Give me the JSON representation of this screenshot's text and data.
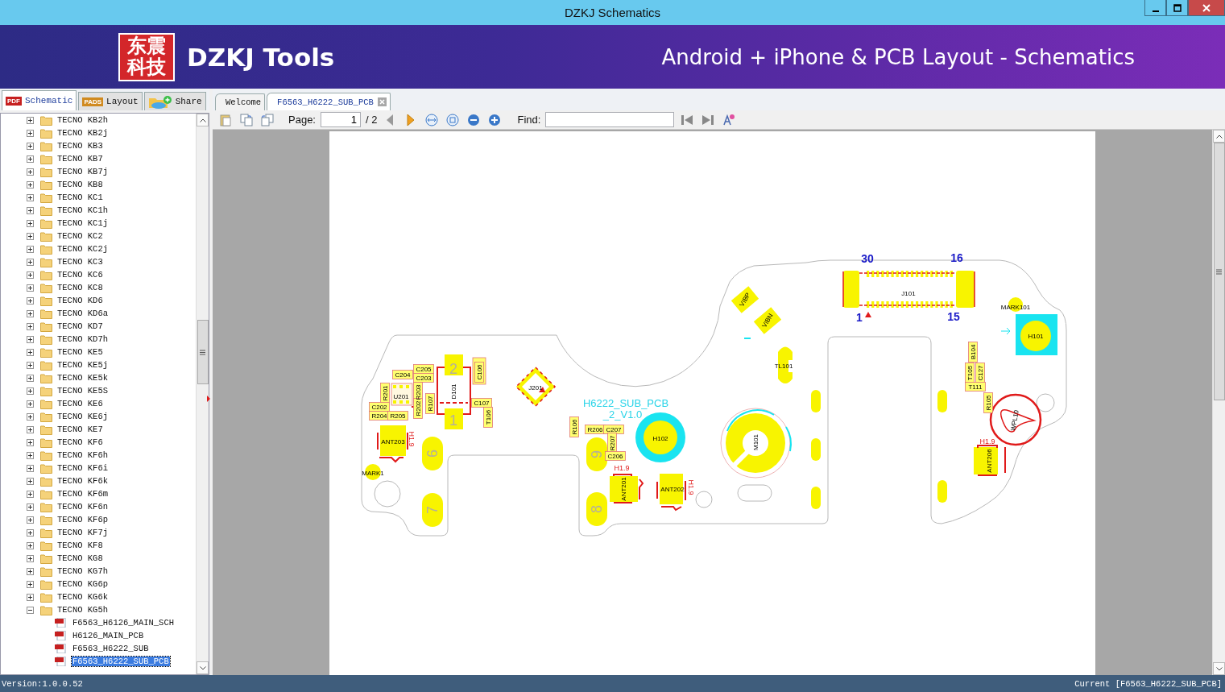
{
  "window": {
    "title": "DZKJ Schematics"
  },
  "banner": {
    "logo_text": "东震科技",
    "brand": "DZKJ Tools",
    "tagline": "Android + iPhone & PCB Layout - Schematics"
  },
  "panel_tabs": [
    {
      "label": "Schematic",
      "badge": "PDF",
      "selected": true
    },
    {
      "label": "Layout",
      "badge": "PADS",
      "selected": false
    },
    {
      "label": "Share",
      "selected": false
    }
  ],
  "doc_tabs": [
    {
      "label": "Welcome",
      "selected": false,
      "closable": false
    },
    {
      "label": "F6563_H6222_SUB_PCB",
      "selected": true,
      "closable": true
    }
  ],
  "tree": [
    {
      "label": "TECNO KB2h",
      "expanded": false
    },
    {
      "label": "TECNO KB2j",
      "expanded": false
    },
    {
      "label": "TECNO KB3",
      "expanded": false
    },
    {
      "label": "TECNO KB7",
      "expanded": false
    },
    {
      "label": "TECNO KB7j",
      "expanded": false
    },
    {
      "label": "TECNO KB8",
      "expanded": false
    },
    {
      "label": "TECNO KC1",
      "expanded": false
    },
    {
      "label": "TECNO KC1h",
      "expanded": false
    },
    {
      "label": "TECNO KC1j",
      "expanded": false
    },
    {
      "label": "TECNO KC2",
      "expanded": false
    },
    {
      "label": "TECNO KC2j",
      "expanded": false
    },
    {
      "label": "TECNO KC3",
      "expanded": false
    },
    {
      "label": "TECNO KC6",
      "expanded": false
    },
    {
      "label": "TECNO KC8",
      "expanded": false
    },
    {
      "label": "TECNO KD6",
      "expanded": false
    },
    {
      "label": "TECNO KD6a",
      "expanded": false
    },
    {
      "label": "TECNO KD7",
      "expanded": false
    },
    {
      "label": "TECNO KD7h",
      "expanded": false
    },
    {
      "label": "TECNO KE5",
      "expanded": false
    },
    {
      "label": "TECNO KE5j",
      "expanded": false
    },
    {
      "label": "TECNO KE5k",
      "expanded": false
    },
    {
      "label": "TECNO KE5S",
      "expanded": false
    },
    {
      "label": "TECNO KE6",
      "expanded": false
    },
    {
      "label": "TECNO KE6j",
      "expanded": false
    },
    {
      "label": "TECNO KE7",
      "expanded": false
    },
    {
      "label": "TECNO KF6",
      "expanded": false
    },
    {
      "label": "TECNO KF6h",
      "expanded": false
    },
    {
      "label": "TECNO KF6i",
      "expanded": false
    },
    {
      "label": "TECNO KF6k",
      "expanded": false
    },
    {
      "label": "TECNO KF6m",
      "expanded": false
    },
    {
      "label": "TECNO KF6n",
      "expanded": false
    },
    {
      "label": "TECNO KF6p",
      "expanded": false
    },
    {
      "label": "TECNO KF7j",
      "expanded": false
    },
    {
      "label": "TECNO KF8",
      "expanded": false
    },
    {
      "label": "TECNO KG8",
      "expanded": false
    },
    {
      "label": "TECNO KG7h",
      "expanded": false
    },
    {
      "label": "TECNO KG6p",
      "expanded": false
    },
    {
      "label": "TECNO KG6k",
      "expanded": false
    },
    {
      "label": "TECNO KG5h",
      "expanded": true,
      "children": [
        {
          "label": "F6563_H6126_MAIN_SCH",
          "selected": false
        },
        {
          "label": "H6126_MAIN_PCB",
          "selected": false
        },
        {
          "label": "F6563_H6222_SUB",
          "selected": false
        },
        {
          "label": "F6563_H6222_SUB_PCB",
          "selected": true
        }
      ]
    }
  ],
  "toolbar": {
    "page_label": "Page:",
    "page_value": "1",
    "page_total": "/ 2",
    "find_label": "Find:"
  },
  "pcb": {
    "labels": [
      {
        "text": "30",
        "kind": "pin"
      },
      {
        "text": "16",
        "kind": "pin"
      },
      {
        "text": "J101",
        "kind": "ref"
      },
      {
        "text": "1",
        "kind": "pin"
      },
      {
        "text": "15",
        "kind": "pin"
      },
      {
        "text": "MARK101",
        "kind": "ref"
      },
      {
        "text": "H101",
        "kind": "ref"
      },
      {
        "text": "B104",
        "kind": "part"
      },
      {
        "text": "T105",
        "kind": "part"
      },
      {
        "text": "C127",
        "kind": "part"
      },
      {
        "text": "T111",
        "kind": "part"
      },
      {
        "text": "R105",
        "kind": "part"
      },
      {
        "text": "WPL10",
        "kind": "ref"
      },
      {
        "text": "H1.9",
        "kind": "height"
      },
      {
        "text": "ANT206",
        "kind": "ref"
      },
      {
        "text": "VIBP",
        "kind": "ref"
      },
      {
        "text": "VIBN",
        "kind": "ref"
      },
      {
        "text": "TL101",
        "kind": "ref"
      },
      {
        "text": "H6222_SUB_PCB",
        "kind": "title"
      },
      {
        "text": "_2_V1.0",
        "kind": "title"
      },
      {
        "text": "R106",
        "kind": "part"
      },
      {
        "text": "R206",
        "kind": "part"
      },
      {
        "text": "C207",
        "kind": "part"
      },
      {
        "text": "R207",
        "kind": "part"
      },
      {
        "text": "C206",
        "kind": "part"
      },
      {
        "text": "H102",
        "kind": "ref"
      },
      {
        "text": "M101",
        "kind": "ref"
      },
      {
        "text": "H1.9",
        "kind": "height"
      },
      {
        "text": "ANT201",
        "kind": "ref"
      },
      {
        "text": "ANT202",
        "kind": "ref"
      },
      {
        "text": "H1.9",
        "kind": "height"
      },
      {
        "text": "C204",
        "kind": "part"
      },
      {
        "text": "C205",
        "kind": "part"
      },
      {
        "text": "C203",
        "kind": "part"
      },
      {
        "text": "R201",
        "kind": "part"
      },
      {
        "text": "U201",
        "kind": "ref"
      },
      {
        "text": "R203",
        "kind": "part"
      },
      {
        "text": "C202",
        "kind": "part"
      },
      {
        "text": "R204",
        "kind": "part"
      },
      {
        "text": "R205",
        "kind": "part"
      },
      {
        "text": "R202",
        "kind": "part"
      },
      {
        "text": "R107",
        "kind": "part"
      },
      {
        "text": "D101",
        "kind": "ref"
      },
      {
        "text": "2",
        "kind": "padnum"
      },
      {
        "text": "1",
        "kind": "padnum"
      },
      {
        "text": "C106",
        "kind": "part"
      },
      {
        "text": "C107",
        "kind": "part"
      },
      {
        "text": "T106",
        "kind": "part"
      },
      {
        "text": "J201",
        "kind": "ref"
      },
      {
        "text": "ANT203",
        "kind": "ref"
      },
      {
        "text": "H1.9",
        "kind": "height"
      },
      {
        "text": "MARK1",
        "kind": "ref"
      },
      {
        "text": "6",
        "kind": "padnum"
      },
      {
        "text": "7",
        "kind": "padnum"
      },
      {
        "text": "9",
        "kind": "padnum"
      },
      {
        "text": "8",
        "kind": "padnum"
      }
    ]
  },
  "status_bar": {
    "version": "Version:1.0.0.52",
    "current": "Current [F6563_H6222_SUB_PCB]"
  }
}
